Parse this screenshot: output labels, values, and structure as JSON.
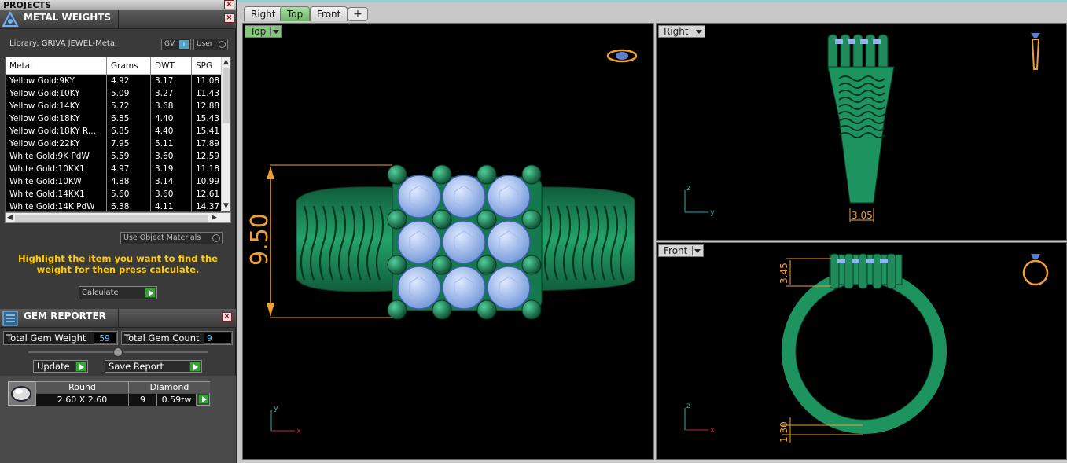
{
  "projects": {
    "title": "PROJECTS"
  },
  "metal_weights": {
    "title": "METAL WEIGHTS",
    "library_label": "Library: GRIVA JEWEL-Metal",
    "gv_label": "GV",
    "user_label": "User",
    "columns": [
      "Metal",
      "Grams",
      "DWT",
      "SPG"
    ],
    "rows": [
      [
        "Yellow Gold:9KY",
        "4.92",
        "3.17",
        "11.08"
      ],
      [
        "Yellow Gold:10KY",
        "5.09",
        "3.27",
        "11.43"
      ],
      [
        "Yellow Gold:14KY",
        "5.72",
        "3.68",
        "12.88"
      ],
      [
        "Yellow Gold:18KY",
        "6.85",
        "4.40",
        "15.43"
      ],
      [
        "Yellow Gold:18KY R...",
        "6.85",
        "4.40",
        "15.41"
      ],
      [
        "Yellow Gold:22KY",
        "7.95",
        "5.11",
        "17.89"
      ],
      [
        "White Gold:9K PdW",
        "5.59",
        "3.60",
        "12.59"
      ],
      [
        "White Gold:10KX1",
        "4.97",
        "3.19",
        "11.18"
      ],
      [
        "White Gold:10KW",
        "4.88",
        "3.14",
        "10.99"
      ],
      [
        "White Gold:14KX1",
        "5.60",
        "3.60",
        "12.61"
      ],
      [
        "White Gold:14K PdW",
        "6.38",
        "4.11",
        "14.37"
      ]
    ],
    "use_object_materials": "Use Object Materials",
    "hint": "Highlight the item you want to find the weight for then press calculate.",
    "calculate_label": "Calculate"
  },
  "gem_reporter": {
    "title": "GEM REPORTER",
    "total_gem_weight_label": "Total Gem Weight",
    "total_gem_weight_value": ".59",
    "total_gem_count_label": "Total Gem Count",
    "total_gem_count_value": "9",
    "update_label": "Update",
    "save_report_label": "Save Report",
    "gem": {
      "shape": "Round",
      "type": "Diamond",
      "size": "2.60 X 2.60",
      "count": "9",
      "weight": "0.59tw"
    }
  },
  "view_tabs": [
    "Right",
    "Top",
    "Front"
  ],
  "active_tab": "Top",
  "viewports": {
    "top": {
      "label": "Top",
      "dimension": "9.50",
      "axis_x": "x",
      "axis_y": "y"
    },
    "right": {
      "label": "Right",
      "dimension": "3.05",
      "axis_h": "y",
      "axis_v": "z"
    },
    "front": {
      "label": "Front",
      "dimension_top": "3.45",
      "dimension_bottom": "1.30",
      "axis_h": "x",
      "axis_v": "z"
    }
  },
  "colors": {
    "metal": "#1f8a5a",
    "gem": "#8fb6ee",
    "dimension": "#f0a030",
    "hint": "#ffcc00"
  }
}
